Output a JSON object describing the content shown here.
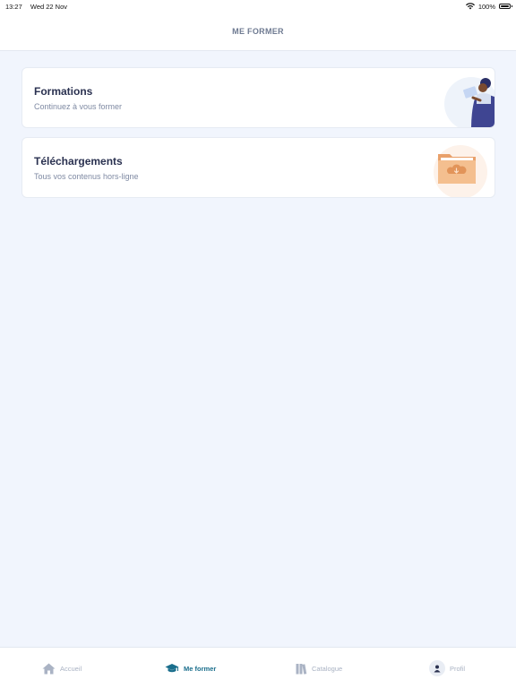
{
  "status_bar": {
    "time": "13:27",
    "date": "Wed 22 Nov",
    "battery": "100%",
    "icons": [
      "wifi-icon",
      "battery-icon"
    ]
  },
  "header": {
    "title": "ME FORMER"
  },
  "cards": [
    {
      "title": "Formations",
      "subtitle": "Continuez à vous former",
      "icon": "person-reading-illustration"
    },
    {
      "title": "Téléchargements",
      "subtitle": "Tous vos contenus hors-ligne",
      "icon": "download-folder-illustration"
    }
  ],
  "tabbar": {
    "items": [
      {
        "label": "Accueil",
        "icon": "home-icon",
        "active": false
      },
      {
        "label": "Me former",
        "icon": "graduation-cap-icon",
        "active": true
      },
      {
        "label": "Catalogue",
        "icon": "books-icon",
        "active": false
      },
      {
        "label": "Profil",
        "icon": "user-icon",
        "active": false
      }
    ]
  },
  "colors": {
    "background": "#f1f5fd",
    "card": "#ffffff",
    "title_text": "#2a3150",
    "subtitle_text": "#7f8aa3",
    "active_tab": "#1a6e8c",
    "inactive_tab": "#a9b2c3",
    "folder_accent": "#f0b27e"
  }
}
